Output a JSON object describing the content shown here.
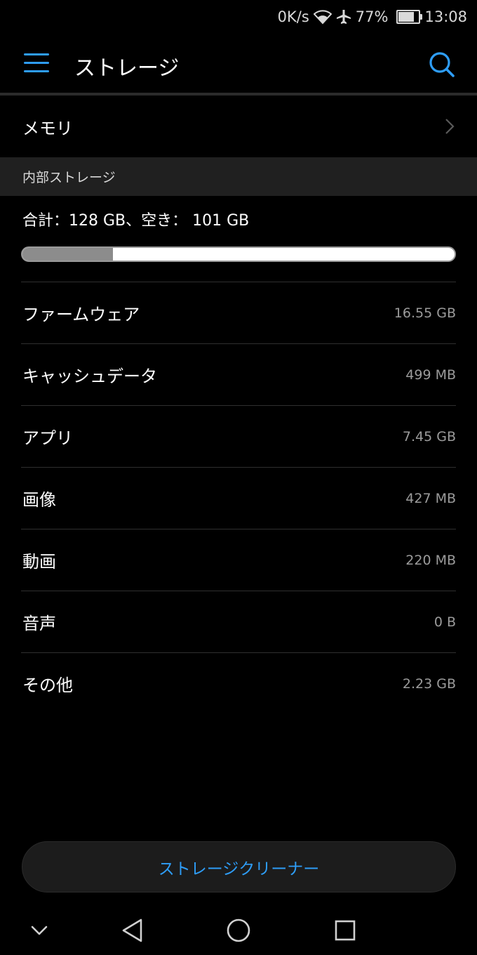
{
  "status_bar": {
    "net_speed": "0K/s",
    "battery_percent_text": "77%",
    "battery_level": 0.77,
    "time": "13:08",
    "icons": [
      "wifi-icon",
      "airplane-icon",
      "battery-icon"
    ]
  },
  "header": {
    "title": "ストレージ",
    "menu_icon": "menu-icon",
    "search_icon": "search-icon"
  },
  "memory": {
    "label": "メモリ",
    "chevron_icon": "chevron-right-icon"
  },
  "internal_storage": {
    "section_title": "内部ストレージ",
    "total_text": "合計：128 GB、空き： 101 GB",
    "used_fraction": 0.21
  },
  "categories": [
    {
      "label": "ファームウェア",
      "size": "16.55 GB"
    },
    {
      "label": "キャッシュデータ",
      "size": "499 MB"
    },
    {
      "label": "アプリ",
      "size": "7.45 GB"
    },
    {
      "label": "画像",
      "size": "427 MB"
    },
    {
      "label": "動画",
      "size": "220 MB"
    },
    {
      "label": "音声",
      "size": "0 B"
    },
    {
      "label": "その他",
      "size": "2.23 GB"
    }
  ],
  "cleaner_button": {
    "label": "ストレージクリーナー"
  },
  "colors": {
    "accent": "#2e9df7",
    "background": "#000000",
    "section_header_bg": "#202020",
    "secondary_text": "#9b9b9b"
  }
}
